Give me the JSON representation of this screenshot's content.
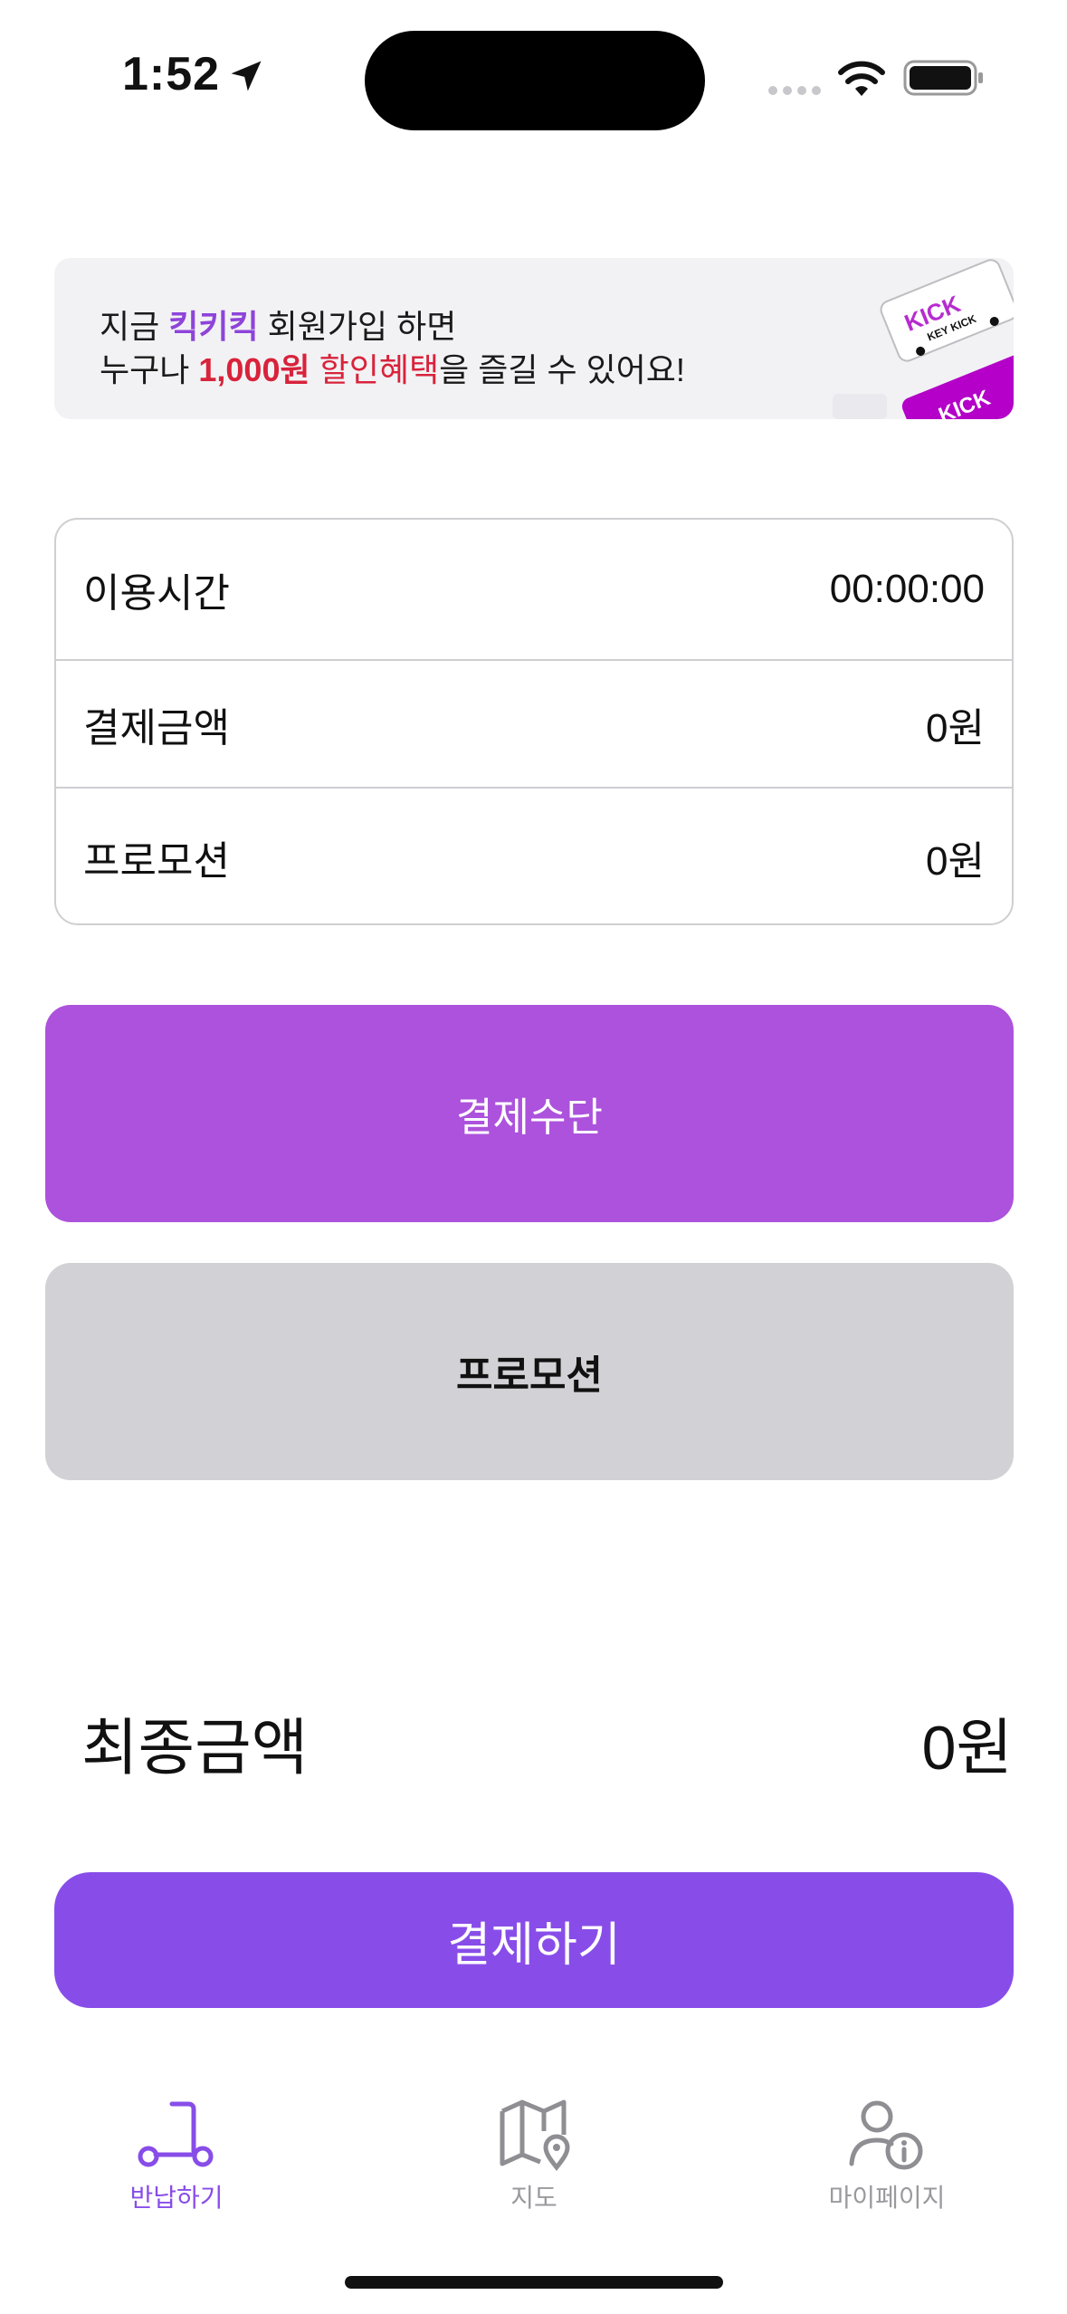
{
  "status_bar": {
    "time": "1:52"
  },
  "banner": {
    "line1_prefix": "지금 ",
    "brand": "킥키킥",
    "line1_suffix": " 회원가입 하면",
    "line2_prefix": "누구나 ",
    "amount": "1,000원",
    "discount": " 할인혜택",
    "line2_suffix": "을 즐길 수 있어요!",
    "logo_text": "KICK",
    "logo_subtext": "KEY KICK"
  },
  "info": {
    "rows": [
      {
        "label": "이용시간",
        "value": "00:00:00"
      },
      {
        "label": "결제금액",
        "value": "0원"
      },
      {
        "label": "프로모션",
        "value": "0원"
      }
    ]
  },
  "buttons": {
    "payment_method": "결제수단",
    "promotion": "프로모션",
    "pay": "결제하기"
  },
  "final": {
    "label": "최종금액",
    "value": "0원"
  },
  "tabs": [
    {
      "label": "반납하기",
      "icon": "scooter-icon",
      "active": true
    },
    {
      "label": "지도",
      "icon": "map-icon",
      "active": false
    },
    {
      "label": "마이페이지",
      "icon": "user-info-icon",
      "active": false
    }
  ],
  "colors": {
    "accent": "#884de9",
    "method_button": "#ac52dc",
    "promo_button": "#d2d2d6",
    "brand_text": "#8e44d9",
    "discount_text": "#d8233b"
  }
}
